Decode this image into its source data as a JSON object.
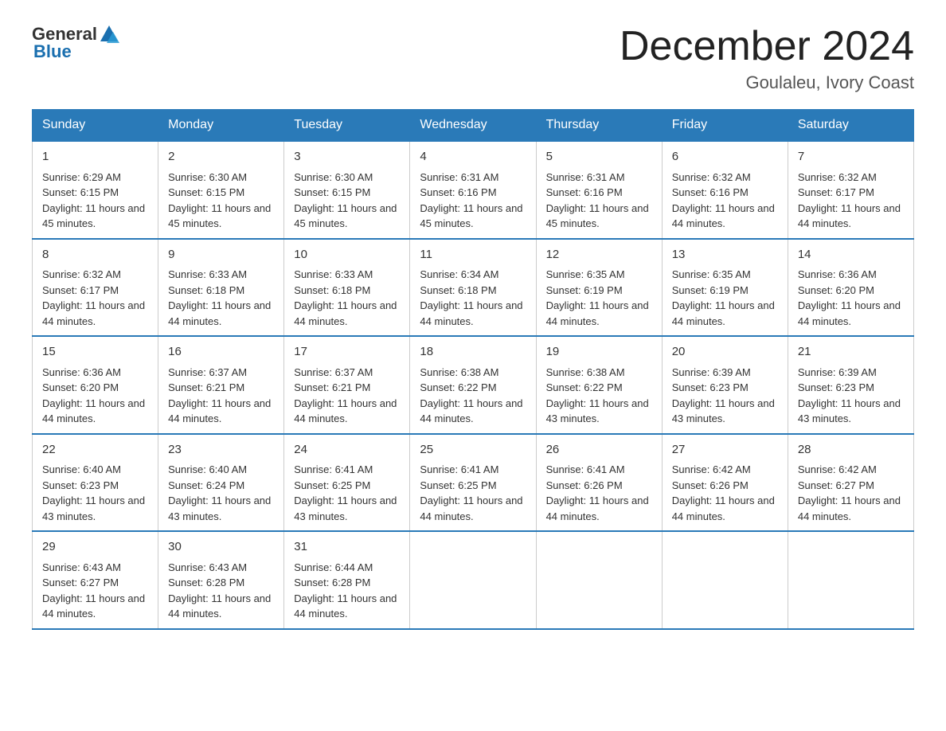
{
  "header": {
    "logo_general": "General",
    "logo_blue": "Blue",
    "title": "December 2024",
    "location": "Goulaleu, Ivory Coast"
  },
  "days_of_week": [
    "Sunday",
    "Monday",
    "Tuesday",
    "Wednesday",
    "Thursday",
    "Friday",
    "Saturday"
  ],
  "weeks": [
    [
      {
        "day": "1",
        "sunrise": "6:29 AM",
        "sunset": "6:15 PM",
        "daylight": "11 hours and 45 minutes."
      },
      {
        "day": "2",
        "sunrise": "6:30 AM",
        "sunset": "6:15 PM",
        "daylight": "11 hours and 45 minutes."
      },
      {
        "day": "3",
        "sunrise": "6:30 AM",
        "sunset": "6:15 PM",
        "daylight": "11 hours and 45 minutes."
      },
      {
        "day": "4",
        "sunrise": "6:31 AM",
        "sunset": "6:16 PM",
        "daylight": "11 hours and 45 minutes."
      },
      {
        "day": "5",
        "sunrise": "6:31 AM",
        "sunset": "6:16 PM",
        "daylight": "11 hours and 45 minutes."
      },
      {
        "day": "6",
        "sunrise": "6:32 AM",
        "sunset": "6:16 PM",
        "daylight": "11 hours and 44 minutes."
      },
      {
        "day": "7",
        "sunrise": "6:32 AM",
        "sunset": "6:17 PM",
        "daylight": "11 hours and 44 minutes."
      }
    ],
    [
      {
        "day": "8",
        "sunrise": "6:32 AM",
        "sunset": "6:17 PM",
        "daylight": "11 hours and 44 minutes."
      },
      {
        "day": "9",
        "sunrise": "6:33 AM",
        "sunset": "6:18 PM",
        "daylight": "11 hours and 44 minutes."
      },
      {
        "day": "10",
        "sunrise": "6:33 AM",
        "sunset": "6:18 PM",
        "daylight": "11 hours and 44 minutes."
      },
      {
        "day": "11",
        "sunrise": "6:34 AM",
        "sunset": "6:18 PM",
        "daylight": "11 hours and 44 minutes."
      },
      {
        "day": "12",
        "sunrise": "6:35 AM",
        "sunset": "6:19 PM",
        "daylight": "11 hours and 44 minutes."
      },
      {
        "day": "13",
        "sunrise": "6:35 AM",
        "sunset": "6:19 PM",
        "daylight": "11 hours and 44 minutes."
      },
      {
        "day": "14",
        "sunrise": "6:36 AM",
        "sunset": "6:20 PM",
        "daylight": "11 hours and 44 minutes."
      }
    ],
    [
      {
        "day": "15",
        "sunrise": "6:36 AM",
        "sunset": "6:20 PM",
        "daylight": "11 hours and 44 minutes."
      },
      {
        "day": "16",
        "sunrise": "6:37 AM",
        "sunset": "6:21 PM",
        "daylight": "11 hours and 44 minutes."
      },
      {
        "day": "17",
        "sunrise": "6:37 AM",
        "sunset": "6:21 PM",
        "daylight": "11 hours and 44 minutes."
      },
      {
        "day": "18",
        "sunrise": "6:38 AM",
        "sunset": "6:22 PM",
        "daylight": "11 hours and 44 minutes."
      },
      {
        "day": "19",
        "sunrise": "6:38 AM",
        "sunset": "6:22 PM",
        "daylight": "11 hours and 43 minutes."
      },
      {
        "day": "20",
        "sunrise": "6:39 AM",
        "sunset": "6:23 PM",
        "daylight": "11 hours and 43 minutes."
      },
      {
        "day": "21",
        "sunrise": "6:39 AM",
        "sunset": "6:23 PM",
        "daylight": "11 hours and 43 minutes."
      }
    ],
    [
      {
        "day": "22",
        "sunrise": "6:40 AM",
        "sunset": "6:23 PM",
        "daylight": "11 hours and 43 minutes."
      },
      {
        "day": "23",
        "sunrise": "6:40 AM",
        "sunset": "6:24 PM",
        "daylight": "11 hours and 43 minutes."
      },
      {
        "day": "24",
        "sunrise": "6:41 AM",
        "sunset": "6:25 PM",
        "daylight": "11 hours and 43 minutes."
      },
      {
        "day": "25",
        "sunrise": "6:41 AM",
        "sunset": "6:25 PM",
        "daylight": "11 hours and 44 minutes."
      },
      {
        "day": "26",
        "sunrise": "6:41 AM",
        "sunset": "6:26 PM",
        "daylight": "11 hours and 44 minutes."
      },
      {
        "day": "27",
        "sunrise": "6:42 AM",
        "sunset": "6:26 PM",
        "daylight": "11 hours and 44 minutes."
      },
      {
        "day": "28",
        "sunrise": "6:42 AM",
        "sunset": "6:27 PM",
        "daylight": "11 hours and 44 minutes."
      }
    ],
    [
      {
        "day": "29",
        "sunrise": "6:43 AM",
        "sunset": "6:27 PM",
        "daylight": "11 hours and 44 minutes."
      },
      {
        "day": "30",
        "sunrise": "6:43 AM",
        "sunset": "6:28 PM",
        "daylight": "11 hours and 44 minutes."
      },
      {
        "day": "31",
        "sunrise": "6:44 AM",
        "sunset": "6:28 PM",
        "daylight": "11 hours and 44 minutes."
      },
      null,
      null,
      null,
      null
    ]
  ],
  "labels": {
    "sunrise": "Sunrise:",
    "sunset": "Sunset:",
    "daylight": "Daylight:"
  }
}
